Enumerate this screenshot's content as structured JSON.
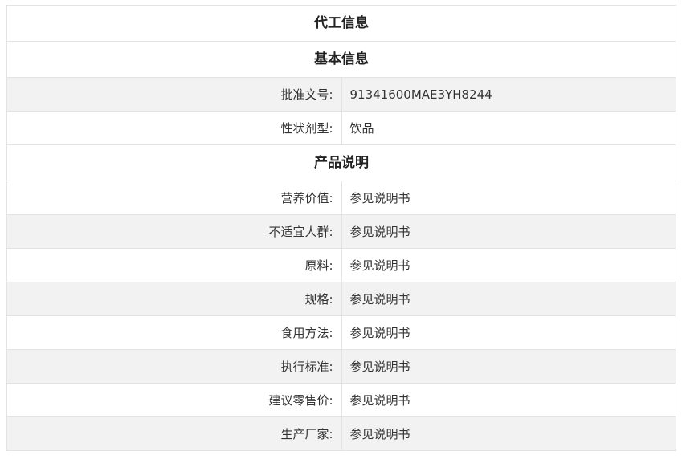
{
  "sections": {
    "oem_title": "代工信息",
    "basic_title": "基本信息",
    "product_title": "产品说明"
  },
  "basic_rows": [
    {
      "label": "批准文号:",
      "value": "91341600MAE3YH8244"
    },
    {
      "label": "性状剂型:",
      "value": "饮品"
    }
  ],
  "product_rows": [
    {
      "label": "营养价值:",
      "value": "参见说明书"
    },
    {
      "label": "不适宜人群:",
      "value": "参见说明书"
    },
    {
      "label": "原料:",
      "value": "参见说明书"
    },
    {
      "label": "规格:",
      "value": "参见说明书"
    },
    {
      "label": "食用方法:",
      "value": "参见说明书"
    },
    {
      "label": "执行标准:",
      "value": "参见说明书"
    },
    {
      "label": "建议零售价:",
      "value": "参见说明书"
    },
    {
      "label": "生产厂家:",
      "value": "参见说明书"
    }
  ]
}
